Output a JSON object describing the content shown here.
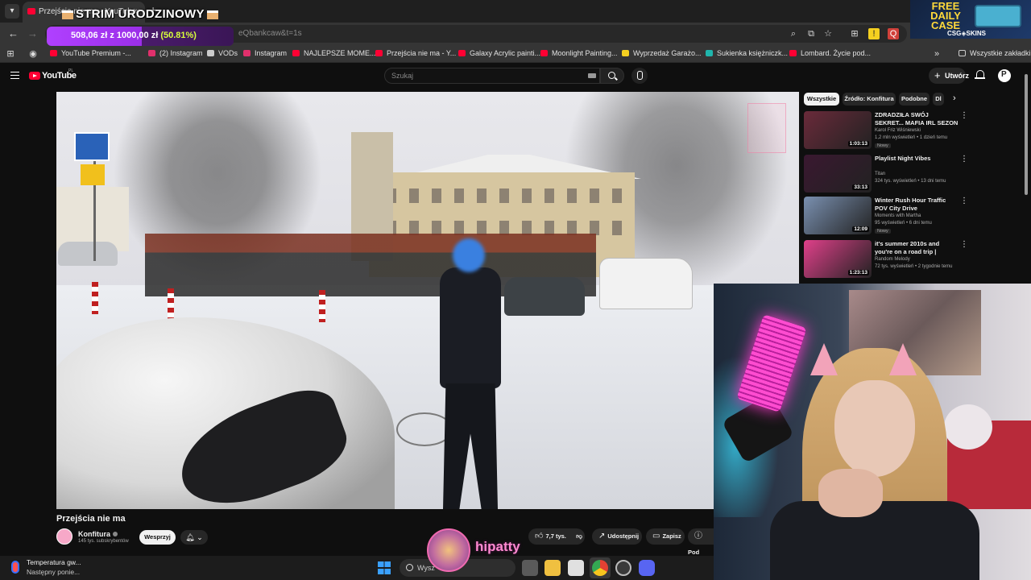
{
  "browser": {
    "tab_title": "Przejścia nie ma - YouTube",
    "address_fragment": "eQbankcaw&t=1s",
    "bookmarks": [
      {
        "label": "YouTube Premium -...",
        "color": "#ff0033"
      },
      {
        "label": "(2) Instagram",
        "color": "#e1306c"
      },
      {
        "label": "VODs",
        "color": "#cccccc"
      },
      {
        "label": "Instagram",
        "color": "#e1306c"
      },
      {
        "label": "NAJLEPSZE MOME...",
        "color": "#ff0033"
      },
      {
        "label": "Przejścia nie ma - Y...",
        "color": "#ff0033"
      },
      {
        "label": "Galaxy Acrylic painti...",
        "color": "#ff0033"
      },
      {
        "label": "Moonlight Painting...",
        "color": "#ff0033"
      },
      {
        "label": "Wyprzedaż Garażo...",
        "color": "#f5d020"
      },
      {
        "label": "Sukienka księżniczk...",
        "color": "#1fb5ac"
      },
      {
        "label": "Lombard. Życie pod...",
        "color": "#ff0033"
      }
    ],
    "all_bookmarks_label": "Wszystkie zakładki"
  },
  "stream": {
    "title": "STRIM URODZINOWY",
    "goal_current": "508,06 zł",
    "goal_sep": "z",
    "goal_target": "1000,00 zł",
    "goal_percent_label": "(50.81%)",
    "goal_fraction": 0.5081,
    "alert_name": "hipatty",
    "promo_line1": "FREE",
    "promo_line2": "DAILY",
    "promo_line3": "CASE",
    "promo_brand": "CSG◈SKINS"
  },
  "youtube": {
    "logo_text": "YouTube",
    "region": "PL",
    "search_placeholder": "Szukaj",
    "create_label": "Utwórz",
    "video_title": "Przejścia nie ma",
    "channel_name": "Konfitura",
    "channel_subs": "145 tys. subskrybentów",
    "support_label": "Wesprzyj",
    "likes": "7,7 tys.",
    "share_label": "Udostępnij",
    "save_label": "Zapisz",
    "more_label": "Pod",
    "chips": [
      "Wszystkie",
      "Źródło: Konfitura",
      "Podobne",
      "Dl"
    ],
    "recommendations": [
      {
        "title": "ZDRADZIŁA SWÓJ SEKRET... MAFIA IRL SEZON 4 odc.3",
        "channel": "Karol Friz Wiśniewski",
        "meta": "1,2 mln wyświetleń • 1 dzień temu",
        "badge": "Nowy",
        "duration": "1:03:13",
        "thumb": "#6a2a3a"
      },
      {
        "title": "Playlist Night Vibes",
        "channel": "Titan",
        "meta": "324 tys. wyświetleń • 13 dni temu",
        "badge": "",
        "duration": "33:13",
        "thumb": "#3a1830"
      },
      {
        "title": "Winter Rush Hour Traffic POV City Drive",
        "channel": "Moments with Martha",
        "meta": "95 wyświetleń • 6 dni temu",
        "badge": "Nowy",
        "duration": "12:09",
        "thumb": "#7a90b0"
      },
      {
        "title": "it's summer 2010s and you're on a road trip | throwback vibe...",
        "channel": "Random Melody",
        "meta": "72 tys. wyświetleń • 2 tygodnie temu",
        "badge": "",
        "duration": "1:23:13",
        "thumb": "#e0408a"
      }
    ]
  },
  "taskbar": {
    "weather_title": "Temperatura gw...",
    "weather_sub": "Następny ponie...",
    "search_label": "Wysz"
  }
}
